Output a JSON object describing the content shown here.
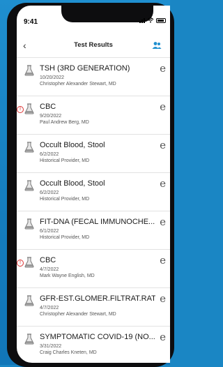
{
  "status_bar": {
    "time": "9:41"
  },
  "header": {
    "back_glyph": "‹",
    "title": "Test Results",
    "people_icon": "people-icon"
  },
  "results": [
    {
      "name": "TSH (3RD GENERATION)",
      "date": "10/20/2022",
      "provider": "Christopher Alexander Stewart, MD",
      "flagged": false
    },
    {
      "name": "CBC",
      "date": "9/20/2022",
      "provider": "Paul Andrew Berg, MD",
      "flagged": true
    },
    {
      "name": "Occult Blood, Stool",
      "date": "6/2/2022",
      "provider": "Historical Provider, MD",
      "flagged": false
    },
    {
      "name": "Occult Blood, Stool",
      "date": "6/2/2022",
      "provider": "Historical Provider, MD",
      "flagged": false
    },
    {
      "name": "FIT-DNA (FECAL IMMUNOCHE...",
      "date": "6/1/2022",
      "provider": "Historical Provider, MD",
      "flagged": false
    },
    {
      "name": "CBC",
      "date": "4/7/2022",
      "provider": "Mark Wayne English, MD",
      "flagged": true
    },
    {
      "name": "GFR-EST.GLOMER.FILTRAT.RATE",
      "date": "4/7/2022",
      "provider": "Christopher Alexander Stewart, MD",
      "flagged": false
    },
    {
      "name": "SYMPTOMATIC COVID-19 (NO...",
      "date": "3/31/2022",
      "provider": "Craig Charles Kneten, MD",
      "flagged": false
    }
  ],
  "flag_glyph": "!",
  "e_glyph": "e",
  "colors": {
    "accent": "#1f8fcf",
    "flag": "#dd3333"
  }
}
